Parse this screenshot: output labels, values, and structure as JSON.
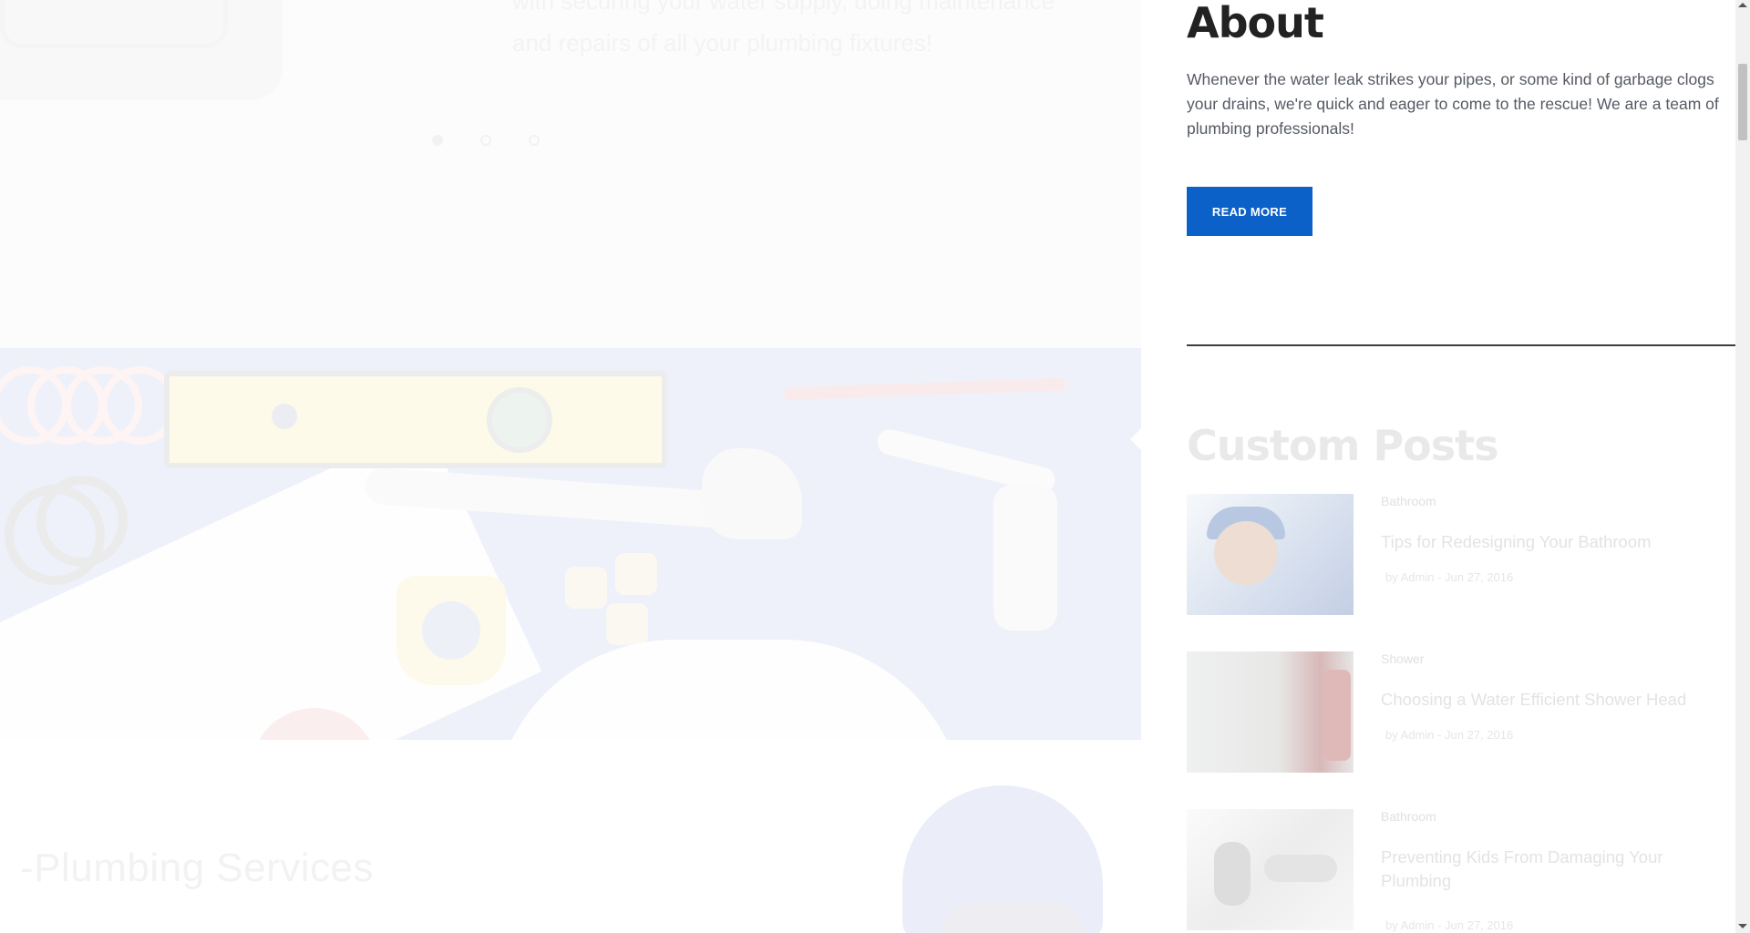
{
  "hero": {
    "text": "with securing your water supply, doing maintenance and repairs of all your plumbing fixtures!",
    "slides": 3,
    "active_slide": 1
  },
  "services": {
    "title": "-Plumbing Services"
  },
  "about": {
    "title": "About",
    "text": "Whenever the water leak strikes your pipes, or some kind of garbage clogs your drains, we're quick and eager to come to the rescue! We are a team of plumbing professionals!",
    "button_label": "READ MORE"
  },
  "custom_posts": {
    "title": "Custom Posts",
    "items": [
      {
        "category": "Bathroom",
        "title": "Tips for Redesigning Your Bathroom",
        "meta": "by Admin  -  Jun 27, 2016"
      },
      {
        "category": "Shower",
        "title": "Choosing a Water Efficient Shower Head",
        "meta": "by Admin  -  Jun 27, 2016"
      },
      {
        "category": "Bathroom",
        "title": "Preventing Kids From Damaging Your Plumbing",
        "meta": "by Admin  -  Jun 27, 2016"
      }
    ]
  },
  "colors": {
    "accent": "#0c61c8",
    "heading": "#222222",
    "body_text": "#555a63"
  }
}
